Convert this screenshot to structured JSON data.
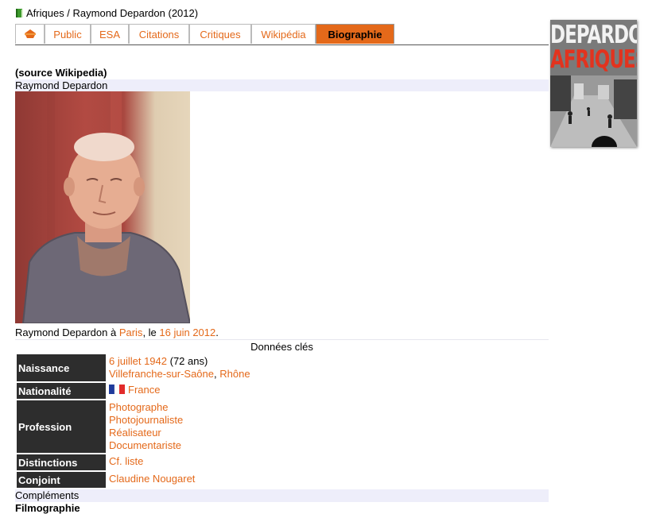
{
  "breadcrumb": "Afriques / Raymond Depardon (2012)",
  "tabs": [
    "Public",
    "ESA",
    "Citations",
    "Critiques",
    "Wikipédia",
    "Biographie"
  ],
  "active_tab": "Biographie",
  "cover": {
    "line1": "DEPARDON",
    "line2": "AFRIQUES"
  },
  "source_label": "(source Wikipedia)",
  "name_header": "Raymond Depardon",
  "caption": {
    "text1": "Raymond Depardon à ",
    "link1": "Paris",
    "text2": ", le ",
    "link2": "16 juin 2012",
    "text3": "."
  },
  "key_data_title": "Données clés",
  "info": {
    "naissance": {
      "label": "Naissance",
      "date": "6 juillet 1942",
      "age": " (72 ans)",
      "place": "Villefranche-sur-Saône",
      "sep": ", ",
      "region": "Rhône"
    },
    "nationalite": {
      "label": "Nationalité",
      "value": "France"
    },
    "profession": {
      "label": "Profession",
      "values": [
        "Photographe",
        "Photojournaliste",
        "Réalisateur",
        "Documentariste"
      ]
    },
    "distinctions": {
      "label": "Distinctions",
      "value": "Cf. liste"
    },
    "conjoint": {
      "label": "Conjoint",
      "value": "Claudine Nougaret"
    }
  },
  "complements": "Compléments",
  "filmography": "Filmographie",
  "colors": {
    "accent": "#e4691a",
    "label_bg": "#2d2d2d",
    "band_bg": "#eeeefa"
  }
}
